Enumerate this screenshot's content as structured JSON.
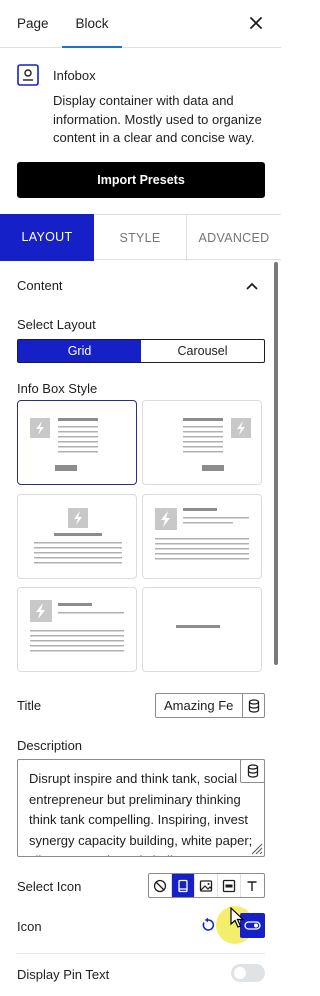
{
  "top_tabs": {
    "page": "Page",
    "block": "Block"
  },
  "block": {
    "name": "Infobox",
    "description": "Display container with data and information. Mostly used to organize content in a clear and concise way.",
    "import_label": "Import Presets"
  },
  "panel_tabs": {
    "layout": "LAYOUT",
    "style": "STYLE",
    "advanced": "ADVANCED"
  },
  "content": {
    "section_title": "Content",
    "select_layout_label": "Select Layout",
    "layout_options": {
      "grid": "Grid",
      "carousel": "Carousel"
    },
    "selected_layout": "Grid",
    "info_box_style_label": "Info Box Style",
    "selected_style_index": 0,
    "title_label": "Title",
    "title_value": "Amazing Fe",
    "description_label": "Description",
    "description_value": "Disrupt inspire and think tank, social entrepreneur but preliminary thinking think tank compelling. Inspiring, invest synergy capacity building, white paper; silo, unprecedented challenge B",
    "select_icon_label": "Select Icon",
    "selected_icon_type": "icon",
    "icon_label": "Icon",
    "display_pin_text_label": "Display Pin Text",
    "display_pin_text_enabled": false
  },
  "colors": {
    "accent": "#1620c7",
    "tab_underline": "#1a73c7",
    "placeholder": "#c8c8c8"
  }
}
